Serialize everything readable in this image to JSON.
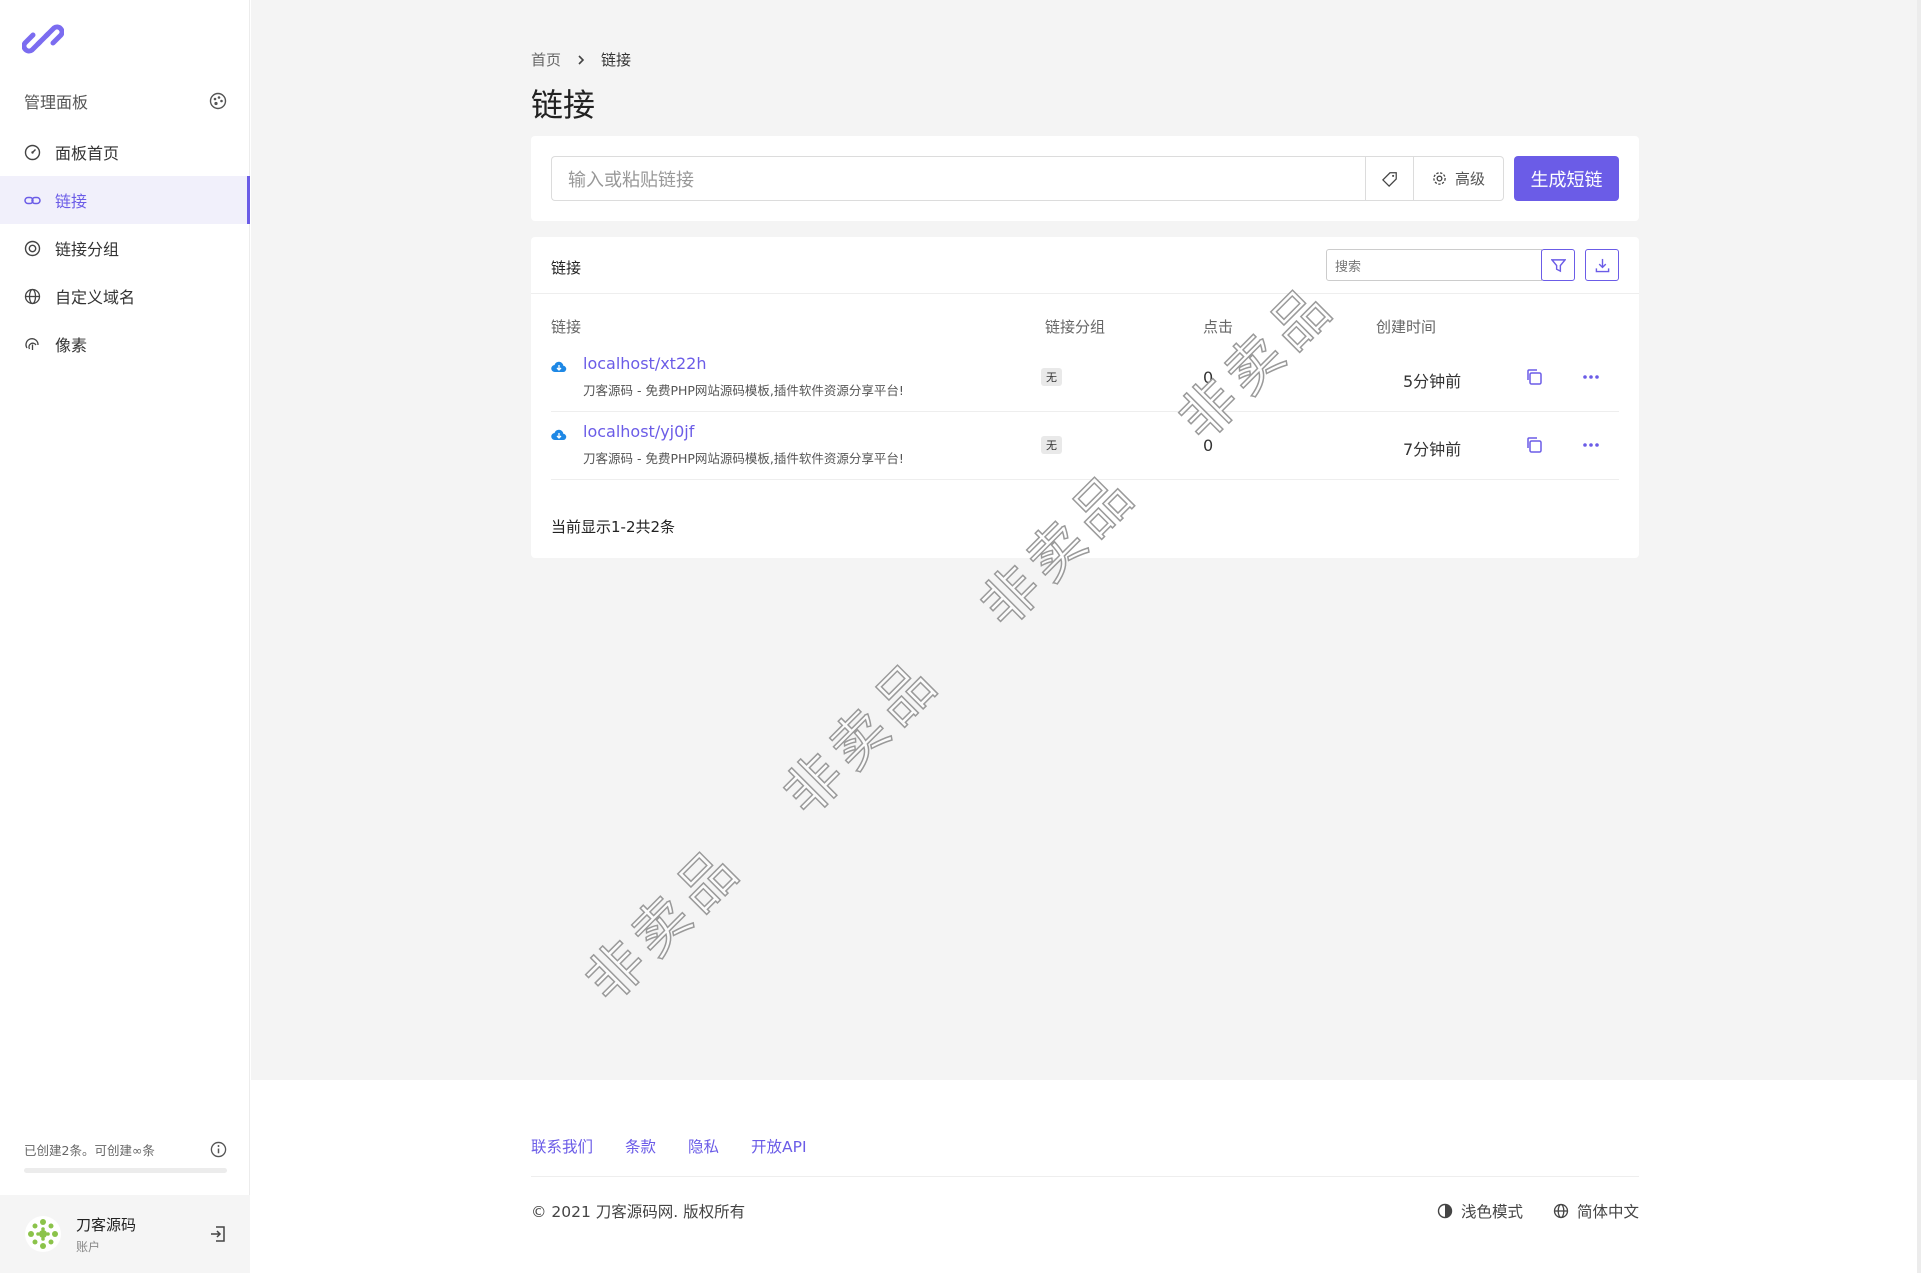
{
  "sidebar": {
    "menu_title": "管理面板",
    "items": [
      {
        "label": "面板首页",
        "icon": "dashboard-icon"
      },
      {
        "label": "链接",
        "icon": "link-icon",
        "active": true
      },
      {
        "label": "链接分组",
        "icon": "target-icon"
      },
      {
        "label": "自定义域名",
        "icon": "globe-icon"
      },
      {
        "label": "像素",
        "icon": "fingerprint-icon"
      }
    ],
    "quota_text": "已创建2条。可创建∞条",
    "account": {
      "name": "刀客源码",
      "role": "账户"
    }
  },
  "breadcrumb": {
    "home": "首页",
    "current": "链接"
  },
  "page_title": "链接",
  "shorten": {
    "placeholder": "输入或粘贴链接",
    "advanced_label": "高级",
    "submit_label": "生成短链"
  },
  "links_card": {
    "title": "链接",
    "search_placeholder": "搜索",
    "columns": {
      "link": "链接",
      "group": "链接分组",
      "clicks": "点击",
      "created": "创建时间"
    },
    "rows": [
      {
        "url": "localhost/xt22h",
        "title": "刀客源码 - 免费PHP网站源码模板,插件软件资源分享平台!",
        "group": "无",
        "clicks": "0",
        "created": "5分钟前"
      },
      {
        "url": "localhost/yj0jf",
        "title": "刀客源码 - 免费PHP网站源码模板,插件软件资源分享平台!",
        "group": "无",
        "clicks": "0",
        "created": "7分钟前"
      }
    ],
    "pager_text": "当前显示1-2共2条"
  },
  "footer": {
    "links": [
      "联系我们",
      "条款",
      "隐私",
      "开放API"
    ],
    "copyright": "© 2021 刀客源码网. 版权所有",
    "theme_label": "浅色模式",
    "language_label": "简体中文"
  },
  "watermark": "非卖品",
  "colors": {
    "accent": "#6b5ce7",
    "cloud": "#1e88e5",
    "background": "#f4f4f4"
  }
}
